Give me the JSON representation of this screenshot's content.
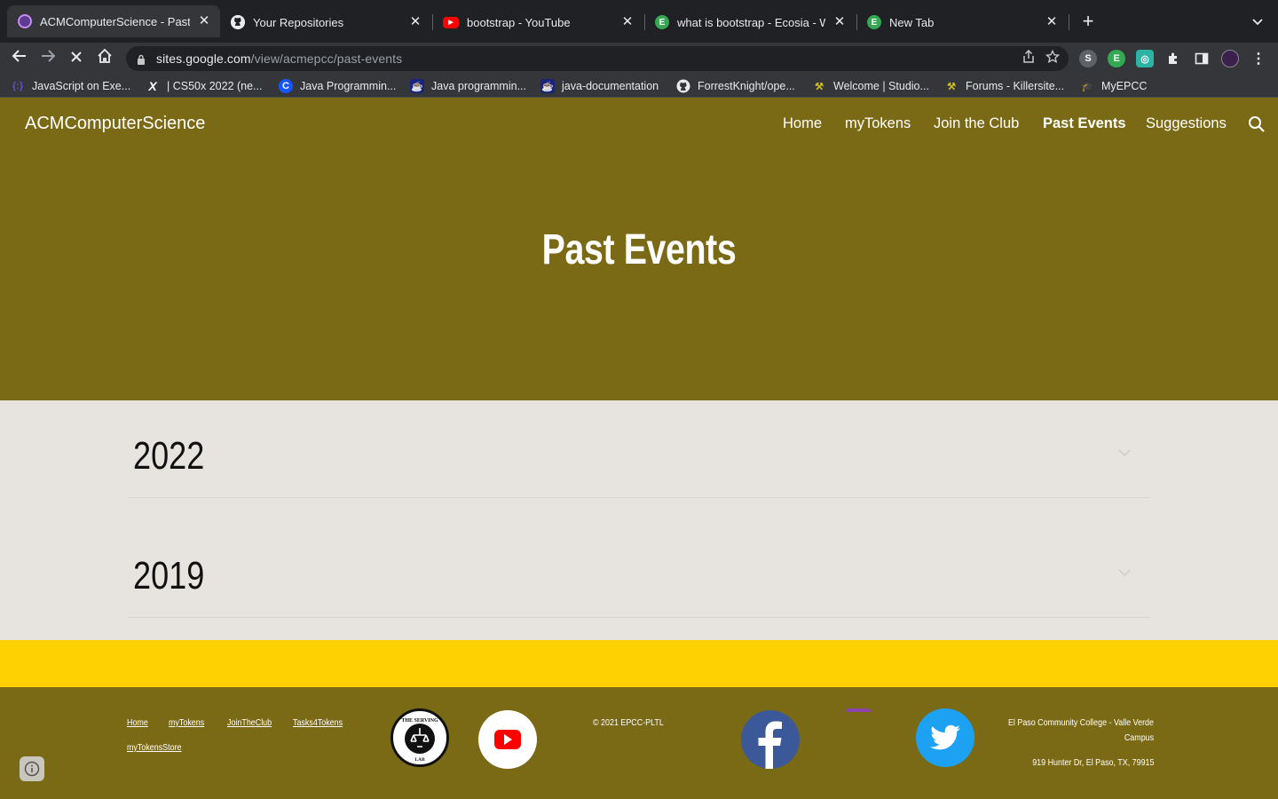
{
  "browser": {
    "tabs": [
      {
        "title": "ACMComputerScience - Past Events",
        "active": true,
        "favicon_color": "#5f3b92"
      },
      {
        "title": "Your Repositories",
        "active": false,
        "favicon_color": "#24292f"
      },
      {
        "title": "bootstrap - YouTube",
        "active": false,
        "favicon_color": "#ff0000"
      },
      {
        "title": "what is bootstrap - Ecosia - Web",
        "active": false,
        "favicon_color": "#34a853"
      },
      {
        "title": "New Tab",
        "active": false,
        "favicon_color": "#34a853"
      }
    ],
    "url_host": "sites.google.com",
    "url_path": "/view/acmepcc/past-events",
    "bookmarks": [
      {
        "label": "JavaScript on Exe...",
        "icon": "exercism-icon",
        "color": "#604fcd"
      },
      {
        "label": "| CS50x 2022 (ne...",
        "icon": "x-icon",
        "color": "#ffffff"
      },
      {
        "label": "Java Programmin...",
        "icon": "codecademy-icon",
        "color": "#1557ff"
      },
      {
        "label": "Java programmin...",
        "icon": "java-icon",
        "color": "#1a237e"
      },
      {
        "label": "java-documentation",
        "icon": "java-icon",
        "color": "#1a237e"
      },
      {
        "label": "ForrestKnight/ope...",
        "icon": "github-icon",
        "color": "#ffffff"
      },
      {
        "label": "Welcome | Studio...",
        "icon": "killersite-icon",
        "color": "#d4c01c"
      },
      {
        "label": "Forums - Killersite...",
        "icon": "killersite-icon",
        "color": "#d4c01c"
      },
      {
        "label": "MyEPCC",
        "icon": "graduation-cap-icon",
        "color": "#8e44ad"
      }
    ]
  },
  "site": {
    "title": "ACMComputerScience",
    "nav": [
      "Home",
      "myTokens",
      "Join the Club",
      "Past Events",
      "Suggestions"
    ],
    "current_nav": "Past Events",
    "page_title": "Past Events",
    "sections": [
      {
        "title": "2022"
      },
      {
        "title": "2019"
      }
    ],
    "colors": {
      "primary": "#7b6a15",
      "accent": "#fed202",
      "background": "#e7e4df"
    }
  },
  "footer": {
    "links": [
      "Home",
      "myTokens",
      "JoinTheClub",
      "Tasks4Tokens",
      "myTokensStore"
    ],
    "copyright": "© 2021 EPCC-PLTL",
    "address_line1": "El Paso Community College - Valle Verde",
    "address_line2": "Campus",
    "address_line3": "919 Hunter Dr, El Paso, TX, 79915",
    "badge_text_top": "THE SERVING",
    "badge_text_bottom": "LAB"
  }
}
